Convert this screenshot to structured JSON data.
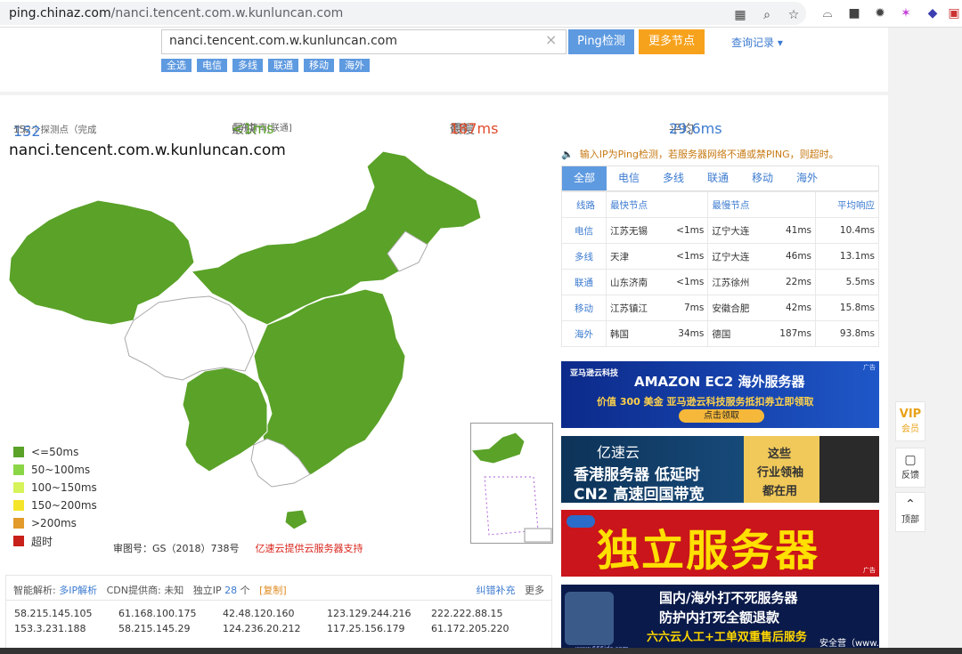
{
  "browser": {
    "url_host": "ping.chinaz.com",
    "url_path": "/nanci.tencent.com.w.kunluncan.com"
  },
  "search": {
    "value": "nanci.tencent.com.w.kunluncan.com",
    "ping_button": "Ping检测",
    "more_nodes_button": "更多节点",
    "query_log": "查询记录",
    "filters": [
      "全选",
      "电信",
      "多线",
      "联通",
      "移动",
      "海外"
    ]
  },
  "stats": {
    "nodes_prefix": "152个探测点（完成",
    "nodes_done": "152",
    "nodes_suffix": "个)",
    "fastest_label": "最快",
    "fastest_node": "山东济南[联通]",
    "fastest_value": "<1ms",
    "slowest_label": "最慢",
    "slowest_node": "德国",
    "slowest_value": "187ms",
    "avg_label": "平均",
    "avg_value": "29.6ms"
  },
  "map": {
    "title": "nanci.tencent.com.w.kunluncan.com",
    "legend": [
      {
        "label": "<=50ms",
        "color": "#5aa228"
      },
      {
        "label": "50~100ms",
        "color": "#8bd646"
      },
      {
        "label": "100~150ms",
        "color": "#d6f35a"
      },
      {
        "label": "150~200ms",
        "color": "#f4e52b"
      },
      {
        "label": ">200ms",
        "color": "#e29a2b"
      },
      {
        "label": "超时",
        "color": "#c8201a"
      }
    ],
    "approval": "审图号：GS（2018）738号",
    "sponsor": "亿速云提供云服务器支持"
  },
  "ip_panel": {
    "resolve_label": "智能解析:",
    "resolve_link": "多IP解析",
    "cdn_label": "CDN提供商: 未知",
    "unique_label": "独立IP",
    "unique_count": "28",
    "unique_unit": "个",
    "copy": "[复制]",
    "correct": "纠错补充",
    "more": "更多",
    "ips": [
      "58.215.145.105",
      "61.168.100.175",
      "42.48.120.160",
      "123.129.244.216",
      "222.222.88.15",
      "153.3.231.188",
      "58.215.145.29",
      "124.236.20.212",
      "117.25.156.179",
      "61.172.205.220"
    ]
  },
  "right": {
    "notice": "输入IP为Ping检测，若服务器网络不通或禁PING，则超时。",
    "tabs": [
      "全部",
      "电信",
      "多线",
      "联通",
      "移动",
      "海外"
    ],
    "table_head": [
      "线路",
      "最快节点",
      "最慢节点",
      "平均响应"
    ],
    "rows": [
      {
        "line": "电信",
        "fast": "江苏无锡",
        "fast_ms": "<1ms",
        "slow": "辽宁大连",
        "slow_ms": "41ms",
        "avg": "10.4ms"
      },
      {
        "line": "多线",
        "fast": "天津",
        "fast_ms": "<1ms",
        "slow": "辽宁大连",
        "slow_ms": "46ms",
        "avg": "13.1ms"
      },
      {
        "line": "联通",
        "fast": "山东济南",
        "fast_ms": "<1ms",
        "slow": "江苏徐州",
        "slow_ms": "22ms",
        "avg": "5.5ms"
      },
      {
        "line": "移动",
        "fast": "江苏镇江",
        "fast_ms": "7ms",
        "slow": "安徽合肥",
        "slow_ms": "42ms",
        "avg": "15.8ms"
      },
      {
        "line": "海外",
        "fast": "韩国",
        "fast_ms": "34ms",
        "slow": "德国",
        "slow_ms": "187ms",
        "avg": "93.8ms"
      }
    ]
  },
  "ads": {
    "a1_brand": "亚马逊云科技",
    "a1_title": "AMAZON EC2 海外服务器",
    "a1_sub": "价值 300 美金 亚马逊云科技服务抵扣券立即领取",
    "a1_btn": "点击领取",
    "ad_tag": "广告",
    "a2_brand": "亿速云",
    "a2_line1": "香港服务器 低延时",
    "a2_line2": "CN2 高速回国带宽",
    "a2_side1": "这些",
    "a2_side2": "行业领袖",
    "a2_side3": "都在用",
    "a3_title": "独立服务器",
    "a4_line1": "国内/海外打不死服务器",
    "a4_line2": "防护内打死全额退款",
    "a4_line3": "六六云人工+工单双重售后服务",
    "a4_url": "www.666idc.com"
  },
  "sidebar": {
    "vip": "会员",
    "feedback": "反馈",
    "top": "顶部"
  },
  "taskbar": {
    "text": "安全营（www."
  }
}
